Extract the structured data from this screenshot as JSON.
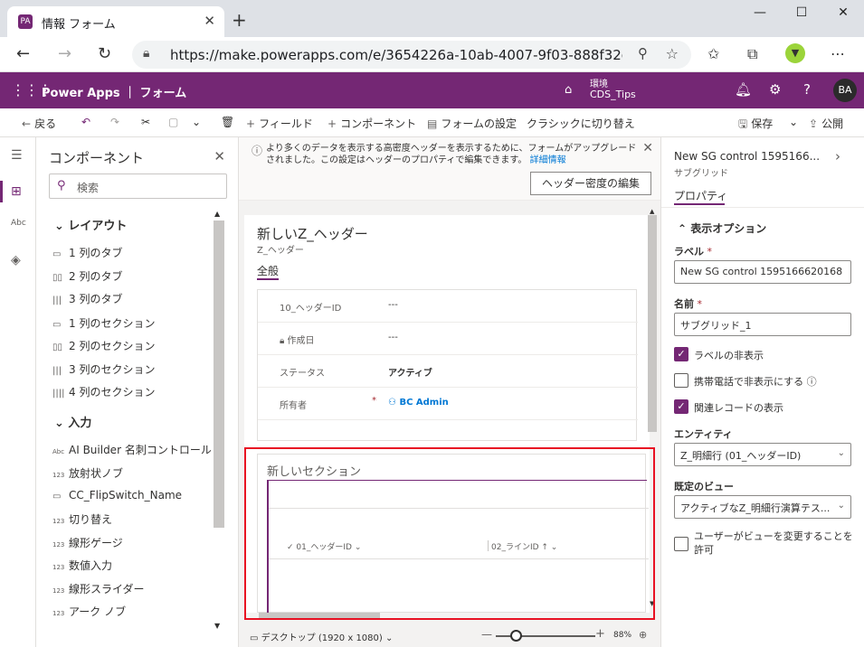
{
  "browser": {
    "tab_title": "情報 フォーム",
    "url": "https://make.powerapps.com/e/3654226a-10ab-4007-9f03-888f32e...",
    "favicon_letter": "PA"
  },
  "app_header": {
    "brand": "Power Apps ｜ フォーム",
    "env_label": "環境",
    "env_name": "CDS_Tips",
    "avatar": "BA"
  },
  "command_bar": {
    "back": "戻る",
    "add_field": "フィールド",
    "add_component": "コンポーネント",
    "form_settings": "フォームの設定",
    "switch_classic": "クラシックに切り替え",
    "save": "保存",
    "publish": "公開"
  },
  "components_panel": {
    "title": "コンポーネント",
    "search_placeholder": "検索",
    "layout_group": "レイアウト",
    "layout_items": [
      {
        "label": "1 列のタブ"
      },
      {
        "label": "2 列のタブ"
      },
      {
        "label": "3 列のタブ"
      },
      {
        "label": "1 列のセクション"
      },
      {
        "label": "2 列のセクション"
      },
      {
        "label": "3 列のセクション"
      },
      {
        "label": "4 列のセクション"
      }
    ],
    "input_group": "入力",
    "input_items": [
      {
        "label": "AI Builder 名刺コントロール"
      },
      {
        "label": "放射状ノブ"
      },
      {
        "label": "CC_FlipSwitch_Name"
      },
      {
        "label": "切り替え"
      },
      {
        "label": "線形ゲージ"
      },
      {
        "label": "数値入力"
      },
      {
        "label": "線形スライダー"
      },
      {
        "label": "アーク ノブ"
      }
    ]
  },
  "banner": {
    "text": "より多くのデータを表示する高密度ヘッダーを表示するために、フォームがアップグレードされました。この設定はヘッダーのプロパティで編集できます。",
    "link": "詳細情報",
    "button": "ヘッダー密度の編集"
  },
  "form": {
    "title": "新しいZ_ヘッダー",
    "subtitle": "Z_ヘッダー",
    "tab": "全般",
    "fields": [
      {
        "label": "10_ヘッダーID",
        "value": "---"
      },
      {
        "label": "作成日",
        "value": "---"
      },
      {
        "label": "ステータス",
        "value": "アクティブ"
      },
      {
        "label": "所有者",
        "value": "BC Admin"
      }
    ],
    "section_title": "新しいセクション",
    "grid_col1": "01_ヘッダーID",
    "grid_col2": "02_ラインID"
  },
  "statusbar": {
    "device": "デスクトップ (1920 x 1080)",
    "zoom": "88%"
  },
  "properties_panel": {
    "title": "New SG control 1595166...",
    "subtitle": "サブグリッド",
    "tab": "プロパティ",
    "section": "表示オプション",
    "label_label": "ラベル",
    "label_value": "New SG control 1595166620168",
    "name_label": "名前",
    "name_value": "サブグリッド_1",
    "hide_label": "ラベルの非表示",
    "hide_phone": "携帯電話で非表示にする",
    "show_related": "関連レコードの表示",
    "entity_label": "エンティティ",
    "entity_value": "Z_明細行 (01_ヘッダーID)",
    "default_view_label": "既定のビュー",
    "default_view_value": "アクティブなZ_明細行演算テス...",
    "allow_change_view": "ユーザーがビューを変更することを許可"
  },
  "colors": {
    "brand": "#742774",
    "highlight": "#e81123",
    "link": "#0078d4"
  }
}
